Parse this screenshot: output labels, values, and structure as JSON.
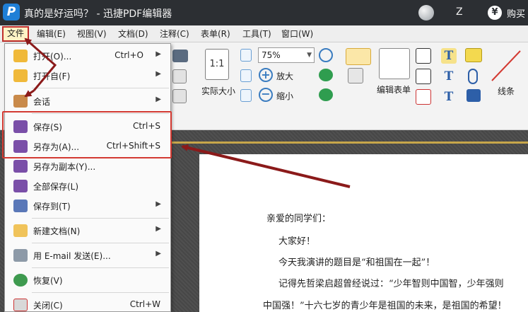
{
  "titlebar": {
    "logo_letter": "P",
    "title": "真的是好运吗？ - 迅捷PDF编辑器",
    "user_initial": "Z",
    "buy_icon": "¥",
    "buy_label": "购买"
  },
  "menubar": {
    "items": [
      "文件",
      "编辑(E)",
      "视图(V)",
      "文档(D)",
      "注释(C)",
      "表单(R)",
      "工具(T)",
      "窗口(W)"
    ]
  },
  "toolbar": {
    "actual_size_icon_text": "1:1",
    "actual_size_label": "实际大小",
    "zoom_value": "75%",
    "zoom_in_label": "放大",
    "zoom_out_label": "缩小",
    "edit_form_label": "编辑表单",
    "line_label": "线条"
  },
  "file_menu": {
    "items": [
      {
        "label": "打开(O)...",
        "shortcut": "Ctrl+O",
        "submenu": true,
        "icon": "open-folder-icon"
      },
      {
        "label": "打开自(F)",
        "shortcut": "",
        "submenu": true,
        "icon": "open-from-icon"
      },
      {
        "label": "会话",
        "shortcut": "",
        "submenu": true,
        "icon": "session-icon"
      },
      {
        "label": "保存(S)",
        "shortcut": "Ctrl+S",
        "submenu": false,
        "icon": "save-icon"
      },
      {
        "label": "另存为(A)...",
        "shortcut": "Ctrl+Shift+S",
        "submenu": false,
        "icon": "save-as-icon"
      },
      {
        "label": "另存为副本(Y)...",
        "shortcut": "",
        "submenu": false,
        "icon": "save-copy-icon"
      },
      {
        "label": "全部保存(L)",
        "shortcut": "",
        "submenu": false,
        "icon": "save-all-icon"
      },
      {
        "label": "保存到(T)",
        "shortcut": "",
        "submenu": true,
        "icon": "save-to-icon"
      },
      {
        "label": "新建文档(N)",
        "shortcut": "",
        "submenu": true,
        "icon": "new-document-icon"
      },
      {
        "label": "用 E-mail 发送(E)...",
        "shortcut": "",
        "submenu": true,
        "icon": "email-icon"
      },
      {
        "label": "恢复(V)",
        "shortcut": "",
        "submenu": false,
        "icon": "revert-icon"
      },
      {
        "label": "关闭(C)",
        "shortcut": "Ctrl+W",
        "submenu": false,
        "icon": "close-document-icon"
      }
    ],
    "submenu_glyph": "▶"
  },
  "document": {
    "lines": [
      "亲爱的同学们：",
      "大家好！",
      "今天我演讲的题目是“和祖国在一起”！",
      "记得先哲梁启超曾经说过：“少年智则中国智，少年强则",
      "中国强！”十六七岁的青少年是祖国的未来，是祖国的希望！"
    ]
  },
  "colors": {
    "annotation_red": "#d33a32",
    "arrow_dark_red": "#8b1a1a",
    "titlebar_bg": "#2c2f33",
    "save_icon_purple": "#7a4fa8"
  }
}
